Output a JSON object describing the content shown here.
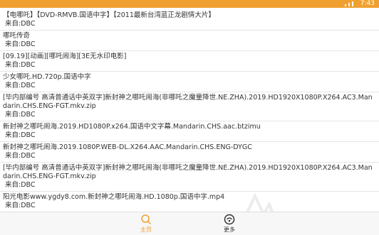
{
  "status_bar": {
    "time": "7:43",
    "background": "#f0a030"
  },
  "list": {
    "items": [
      {
        "title": "【电哪吒】【DVD-RMVB.国语中字】【2011最新台湾蓝正龙剧情大片】",
        "source": "来自:DBC"
      },
      {
        "title": "哪吒传奇",
        "source": "来自:DBC"
      },
      {
        "title": "[09.19][动画][哪吒闹海][3E无水印电影]",
        "source": "来自:DBC"
      },
      {
        "title": "少女哪吒.HD.720p.国语中字",
        "source": "来自:DBC"
      },
      {
        "title": "[毕内部编号 高清普通话中英双字]新封神之哪吒闹海(非哪吒之魔童降世.NE.ZHA).2019.HD1920X1080P.X264.AC3.Mandarin.CHS.ENG-FGT.mkv.zip",
        "source": "来自:DBC"
      },
      {
        "title": "新封神之哪吒闹海.2019.HD1080P.x264.国语中文字幕.Mandarin.CHS.aac.btzimu",
        "source": "来自:DBC"
      },
      {
        "title": "新封神之哪吒闹海.2019.1080P.WEB-DL.X264.AAC.Mandarin.CHS.ENG-DYGC",
        "source": "来自:DBC"
      },
      {
        "title": "[毕内部编号 高清普通话中英双字]新封神之哪吒闹海(非哪吒之魔童降世.NE.ZHA).2019.HD1920X1080P.X264.AC3.Mandarin.CHS.ENG-FGT.mkv.zip",
        "source": "来自:DBC"
      },
      {
        "title": "阳光电影www.ygdy8.com.新封神之哪吒闹海.HD.1080p.国语中字.mp4",
        "source": "来自:DBC"
      }
    ]
  },
  "tab_bar": {
    "home_label": "主页",
    "home_icon": "search-icon",
    "more_label": "更多",
    "more_icon": "more-circle-icon",
    "active_color": "#f0a030"
  }
}
